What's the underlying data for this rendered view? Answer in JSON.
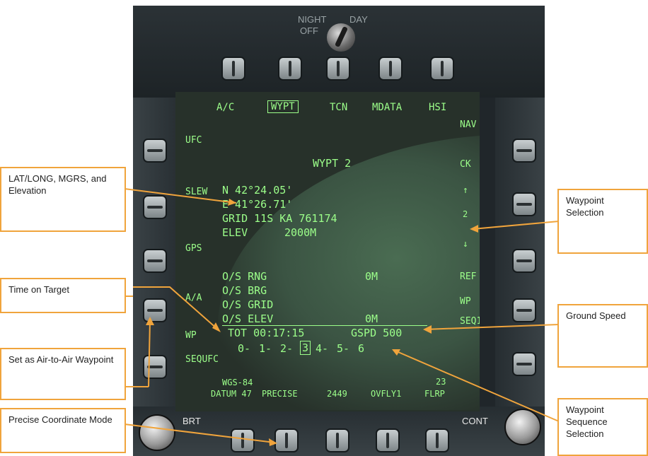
{
  "ddi": {
    "night_label": "NIGHT",
    "off_label": "OFF",
    "day_label": "DAY",
    "brt_label": "BRT",
    "cont_label": "CONT"
  },
  "top_menu": [
    {
      "label": "A/C",
      "selected": false
    },
    {
      "label": "WYPT",
      "selected": true
    },
    {
      "label": "TCN",
      "selected": false
    },
    {
      "label": "MDATA",
      "selected": false
    },
    {
      "label": "HSI",
      "selected": false
    }
  ],
  "left_options": [
    "UFC",
    "SLEW",
    "GPS",
    "A/A",
    "WP",
    "SEQUFC"
  ],
  "right_options": [
    "NAV",
    "CK",
    "2",
    "REF",
    "WP",
    "SEQ1"
  ],
  "screen": {
    "title": "WYPT 2",
    "lat": "N 42°24.05'",
    "long": "E 41°26.71'",
    "grid": "GRID 11S KA 761174",
    "elev_label": "ELEV",
    "elev_value": "2000M",
    "os_rng_label": "O/S RNG",
    "os_rng_value": "0M",
    "os_brg_label": "O/S BRG",
    "os_grid_label": "O/S GRID",
    "os_elev_label": "O/S ELEV",
    "os_elev_value": "0M",
    "tot": "TOT 00:17:15",
    "gspd": "GSPD 500",
    "sequence": [
      "0-",
      "1-",
      "2-",
      "3",
      "4-",
      "5-",
      "6"
    ],
    "sequence_selected": "3",
    "datum_line1": "WGS-84",
    "datum_line2": "DATUM 47",
    "precise": "PRECISE",
    "num_2449": "2449",
    "ovfly": "OVFLY1",
    "flrp": "FLRP",
    "page_num": "23"
  },
  "callouts": {
    "latlong": "LAT/LONG, MGRS, and Elevation",
    "tot": "Time on Target",
    "aa_wp": "Set as Air-to-Air Waypoint",
    "precise": "Precise Coordinate Mode",
    "wp_sel": "Waypoint Selection",
    "gspd": "Ground Speed",
    "wp_seq": "Waypoint Sequence Selection"
  },
  "colors": {
    "accent": "#f0a43c",
    "phosphor": "#9cff8a",
    "screen": "#27312a"
  }
}
